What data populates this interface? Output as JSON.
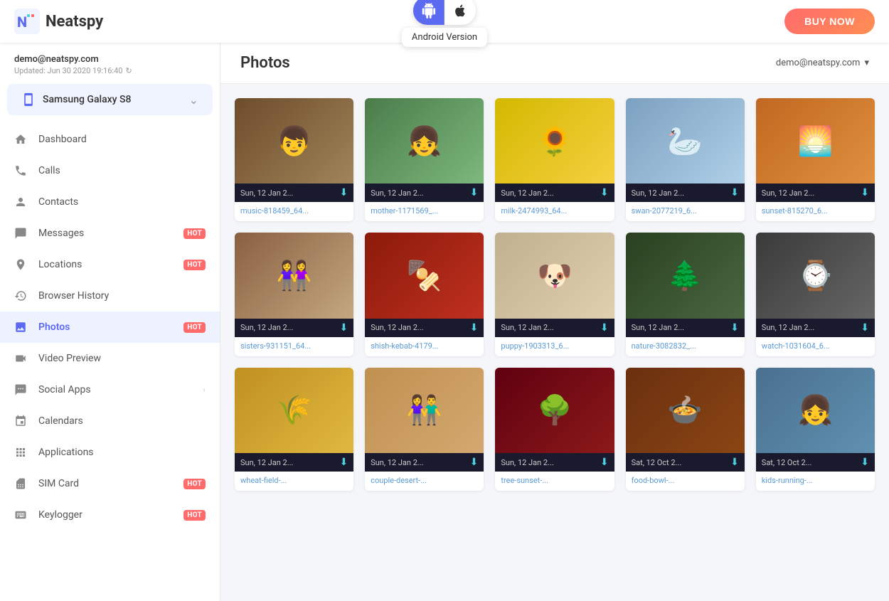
{
  "app": {
    "logo_text": "Neatspy",
    "buy_label": "BUY NOW"
  },
  "platform": {
    "android_label": "Android",
    "apple_label": "Apple",
    "tooltip": "Android Version"
  },
  "sidebar": {
    "email": "demo@neatspy.com",
    "updated": "Updated: Jun 30 2020 19:16:40",
    "device": "Samsung Galaxy S8",
    "nav_items": [
      {
        "id": "dashboard",
        "label": "Dashboard",
        "badge": null,
        "has_arrow": false
      },
      {
        "id": "calls",
        "label": "Calls",
        "badge": null,
        "has_arrow": false
      },
      {
        "id": "contacts",
        "label": "Contacts",
        "badge": null,
        "has_arrow": false
      },
      {
        "id": "messages",
        "label": "Messages",
        "badge": "HOT",
        "has_arrow": false
      },
      {
        "id": "locations",
        "label": "Locations",
        "badge": "HOT",
        "has_arrow": false
      },
      {
        "id": "browser-history",
        "label": "Browser History",
        "badge": null,
        "has_arrow": false
      },
      {
        "id": "photos",
        "label": "Photos",
        "badge": "HOT",
        "has_arrow": false,
        "active": true
      },
      {
        "id": "video-preview",
        "label": "Video Preview",
        "badge": null,
        "has_arrow": false
      },
      {
        "id": "social-apps",
        "label": "Social Apps",
        "badge": null,
        "has_arrow": true
      },
      {
        "id": "calendars",
        "label": "Calendars",
        "badge": null,
        "has_arrow": false
      },
      {
        "id": "applications",
        "label": "Applications",
        "badge": null,
        "has_arrow": false
      },
      {
        "id": "sim-card",
        "label": "SIM Card",
        "badge": "HOT",
        "has_arrow": false
      },
      {
        "id": "keylogger",
        "label": "Keylogger",
        "badge": "HOT",
        "has_arrow": false
      }
    ]
  },
  "content": {
    "page_title": "Photos",
    "user_email": "demo@neatspy.com"
  },
  "photos": [
    {
      "date": "Sun, 12 Jan 2...",
      "filename": "music-818459_64...",
      "color": "#8B7355",
      "emoji": "👦"
    },
    {
      "date": "Sun, 12 Jan 2...",
      "filename": "mother-1171569_...",
      "color": "#7db87d",
      "emoji": "👧"
    },
    {
      "date": "Sun, 12 Jan 2...",
      "filename": "milk-2474993_64...",
      "color": "#f5c842",
      "emoji": "🌻"
    },
    {
      "date": "Sun, 12 Jan 2...",
      "filename": "swan-2077219_6...",
      "color": "#b0c4d8",
      "emoji": "🦢"
    },
    {
      "date": "Sun, 12 Jan 2...",
      "filename": "sunset-815270_6...",
      "color": "#e8823a",
      "emoji": "🌅"
    },
    {
      "date": "Sun, 12 Jan 2...",
      "filename": "sisters-931151_64...",
      "color": "#c4a882",
      "emoji": "👭"
    },
    {
      "date": "Sun, 12 Jan 2...",
      "filename": "shish-kebab-4179...",
      "color": "#c0392b",
      "emoji": "🍢"
    },
    {
      "date": "Sun, 12 Jan 2...",
      "filename": "puppy-1903313_6...",
      "color": "#d4c5a9",
      "emoji": "🐶"
    },
    {
      "date": "Sun, 12 Jan 2...",
      "filename": "nature-3082832_...",
      "color": "#4a6741",
      "emoji": "🌲"
    },
    {
      "date": "Sun, 12 Jan 2...",
      "filename": "watch-1031604_6...",
      "color": "#555",
      "emoji": "⌚"
    },
    {
      "date": "Sun, 12 Jan 2...",
      "filename": "wheat-field-...",
      "color": "#d4a843",
      "emoji": "🌾"
    },
    {
      "date": "Sun, 12 Jan 2...",
      "filename": "couple-desert-...",
      "color": "#c8a86b",
      "emoji": "👫"
    },
    {
      "date": "Sun, 12 Jan 2...",
      "filename": "tree-sunset-...",
      "color": "#8b1a1a",
      "emoji": "🌳"
    },
    {
      "date": "Sat, 12 Oct 2...",
      "filename": "food-bowl-...",
      "color": "#8B4513",
      "emoji": "🍲"
    },
    {
      "date": "Sat, 12 Oct 2...",
      "filename": "kids-running-...",
      "color": "#7aabcf",
      "emoji": "👧"
    }
  ]
}
